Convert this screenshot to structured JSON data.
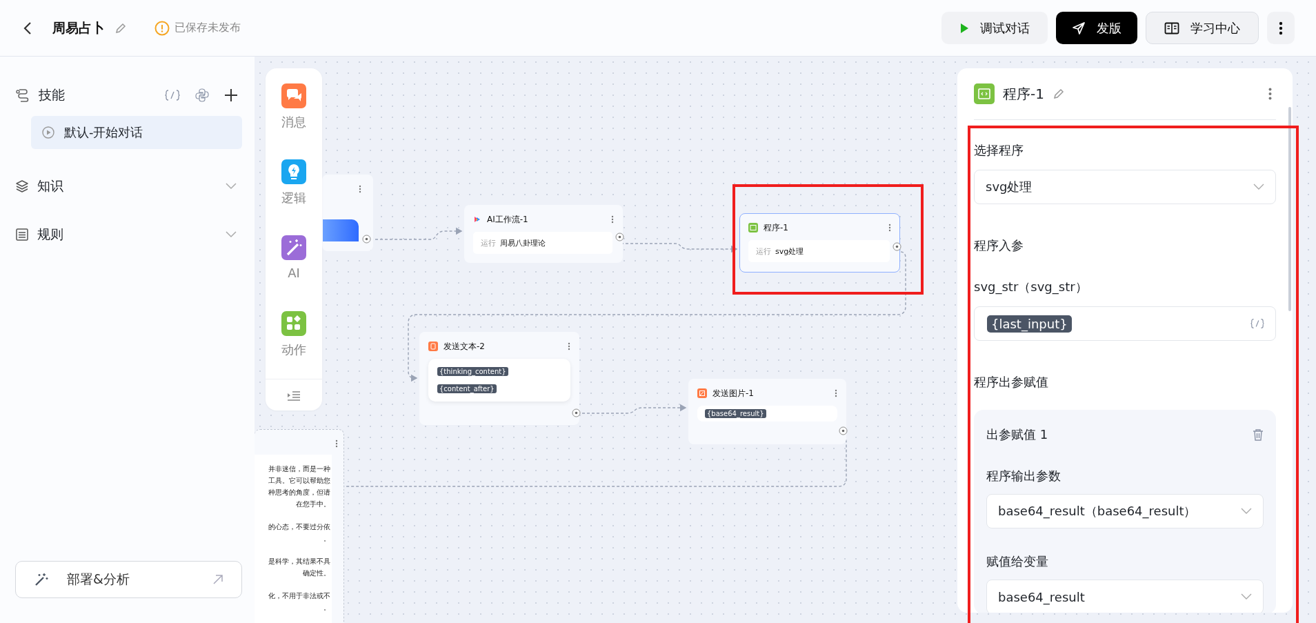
{
  "header": {
    "title": "周易占卜",
    "status": "已保存未发布",
    "buttons": [
      {
        "kind": "debug",
        "label": "调试对话"
      },
      {
        "kind": "publish",
        "label": "发版"
      },
      {
        "kind": "learn",
        "label": "学习中心"
      }
    ]
  },
  "sidebar": {
    "skills": {
      "label": "技能",
      "items": [
        {
          "label": "默认-开始对话",
          "selected": true
        }
      ]
    },
    "sections": [
      {
        "kind": "knowledge",
        "label": "知识",
        "expanded": false
      },
      {
        "kind": "rules",
        "label": "规则",
        "expanded": false
      }
    ],
    "footer_button": "部署&分析"
  },
  "palette": [
    {
      "kind": "message",
      "label": "消息"
    },
    {
      "kind": "logic",
      "label": "逻辑"
    },
    {
      "kind": "ai",
      "label": "AI"
    },
    {
      "kind": "action",
      "label": "动作"
    }
  ],
  "canvas": {
    "nodes": [
      {
        "kind": "start",
        "selected": false
      },
      {
        "kind": "workflow",
        "title": "AI工作流-1",
        "run_label": "运行",
        "run_value": "周易八卦理论",
        "selected": false
      },
      {
        "kind": "program",
        "title": "程序-1",
        "run_label": "运行",
        "run_value": "svg处理",
        "selected": true
      },
      {
        "kind": "text",
        "title": "发送文本-2",
        "tags": [
          "{thinking_content}",
          "{content_after}"
        ],
        "selected": false
      },
      {
        "kind": "image",
        "title": "发送图片-1",
        "tags": [
          "{base64_result}"
        ],
        "selected": false
      },
      {
        "kind": "reply",
        "selected": false,
        "lines": [
          "并非迷信，而是一种",
          "工具。它可以帮助您",
          "种思考的角度，但请",
          "在您手中。",
          "的心态，不要过分依",
          "。",
          "是科学，其结果不具",
          "确定性。",
          "化，不用于非法或不",
          "。"
        ]
      }
    ]
  },
  "panel": {
    "title": "程序-1",
    "program_label": "选择程序",
    "program_value": "svg处理",
    "inputs_heading": "程序入参",
    "inputs": [
      {
        "label": "svg_str（svg_str）",
        "tag": "{last_input}"
      }
    ],
    "outputs_heading": "程序出参赋值",
    "outputs": [
      {
        "title": "出参赋值 1",
        "param_label": "程序输出参数",
        "param_value": "base64_result（base64_result）",
        "var_label": "赋值给变量",
        "var_value": "base64_result"
      }
    ]
  }
}
